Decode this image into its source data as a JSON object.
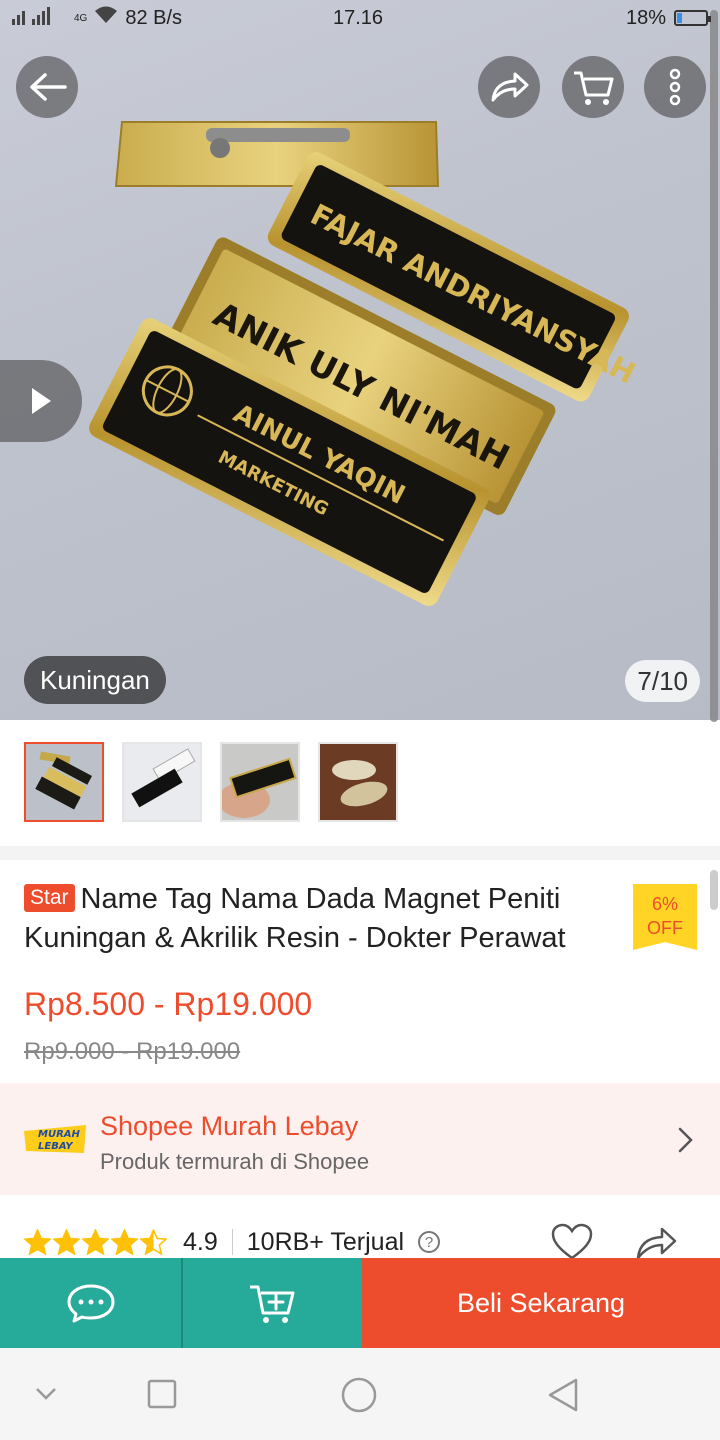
{
  "status_bar": {
    "network": "4G",
    "speed": "82 B/s",
    "time": "17.16",
    "battery": "18%",
    "battery_level": 0.18
  },
  "header": {
    "back_icon": "arrow-left-icon",
    "share_icon": "share-arrow-icon",
    "cart_icon": "cart-icon",
    "more_icon": "more-vertical-icon"
  },
  "gallery": {
    "variant_label": "Kuningan",
    "counter": "7/10",
    "play_icon": "play-icon",
    "image_texts": [
      "FAJAR ANDRIYANSYAH",
      "ANIK ULY NI'MAH",
      "AINUL YAQIN",
      "MARKETING"
    ]
  },
  "product": {
    "badge": "Star",
    "title": "Name Tag Nama Dada Magnet Peniti Kuningan & Akrilik Resin - Dokter Perawat",
    "discount_line1": "6%",
    "discount_line2": "OFF",
    "price": "Rp8.500 - Rp19.000",
    "old_price": "Rp9.000 - Rp19.000"
  },
  "promo": {
    "logo_text1": "MURAH",
    "logo_text2": "LEBAY",
    "title": "Shopee Murah Lebay",
    "subtitle": "Produk termurah di Shopee"
  },
  "rating": {
    "stars": 4.5,
    "value": "4.9",
    "sold": "10RB+ Terjual",
    "help": "?"
  },
  "actions": {
    "buy_label": "Beli Sekarang"
  },
  "colors": {
    "brand": "#ee4d2d",
    "teal": "#26aa99",
    "star": "#ffc107"
  }
}
